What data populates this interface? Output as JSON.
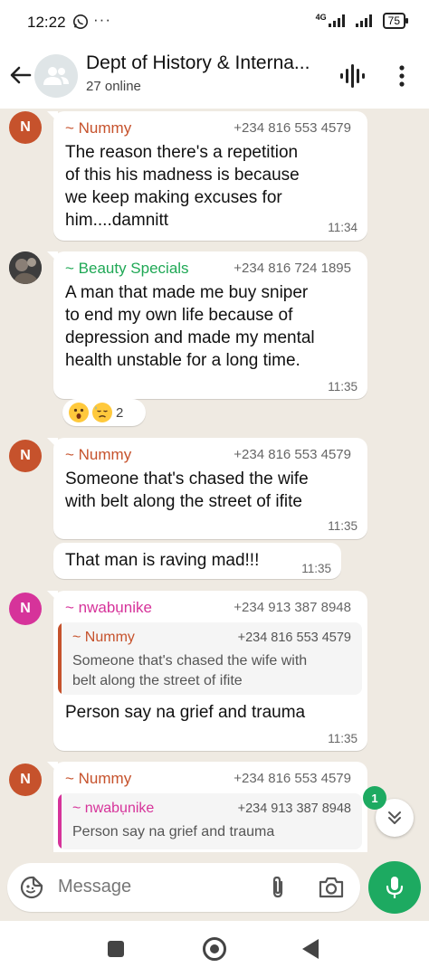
{
  "status_bar": {
    "time": "12:22",
    "more": "···",
    "network": "4G",
    "battery": "75"
  },
  "header": {
    "title": "Dept of History & Interna...",
    "subtitle": "27 online"
  },
  "colors": {
    "nummy": "#c0392b",
    "beauty": "#1fa855",
    "nwabunike": "#d6339a",
    "green": "#1daa61"
  },
  "messages": [
    {
      "avatar_letter": "N",
      "sender": "~ Nummy",
      "phone": "+234 816 553 4579",
      "lines": [
        "The reason there's a repetition",
        "of this his madness is because",
        "we keep making excuses for",
        "him....damnitt"
      ],
      "time": "11:34"
    },
    {
      "sender": "~ Beauty Specials",
      "phone": "+234 816 724 1895",
      "lines": [
        "A man that made me buy sniper",
        "to end my own life because of",
        "depression and made my mental",
        "health unstable for a long time."
      ],
      "time": "11:35",
      "reaction_count": "2"
    },
    {
      "avatar_letter": "N",
      "sender": "~ Nummy",
      "phone": "+234 816 553 4579",
      "lines": [
        "Someone that's chased the wife",
        "with belt along the street of ifite"
      ],
      "time": "11:35"
    },
    {
      "text": "That man is raving mad!!!",
      "time": "11:35"
    },
    {
      "avatar_letter": "N",
      "sender": "~ nwabụnike",
      "phone": "+234 913 387 8948",
      "quote": {
        "sender": "~ Nummy",
        "phone": "+234 816 553 4579",
        "lines": [
          "Someone that's chased the wife with",
          "belt along the street of ifite"
        ]
      },
      "text": "Person say na grief and trauma",
      "time": "11:35"
    },
    {
      "avatar_letter": "N",
      "sender": "~ Nummy",
      "phone": "+234 816 553 4579",
      "quote": {
        "sender": "~ nwabụnike",
        "phone": "+234 913 387 8948",
        "text": "Person say na grief and trauma"
      }
    }
  ],
  "unread_count": "1",
  "input": {
    "placeholder": "Message"
  }
}
